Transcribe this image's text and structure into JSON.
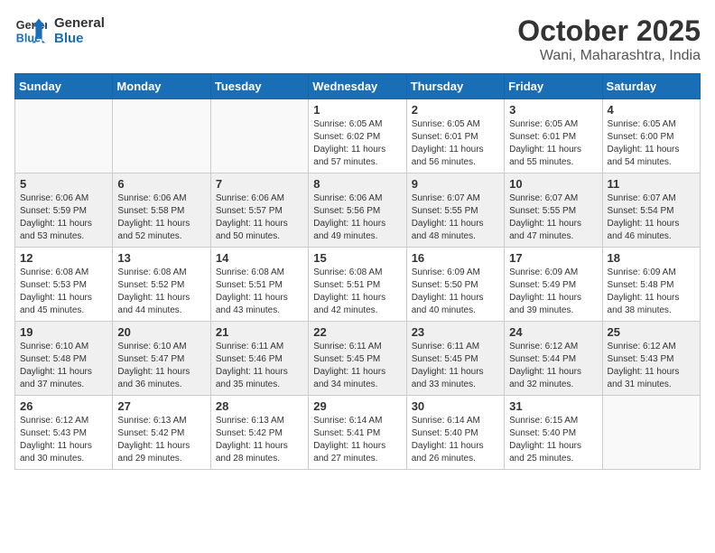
{
  "header": {
    "logo_line1": "General",
    "logo_line2": "Blue",
    "month": "October 2025",
    "location": "Wani, Maharashtra, India"
  },
  "weekdays": [
    "Sunday",
    "Monday",
    "Tuesday",
    "Wednesday",
    "Thursday",
    "Friday",
    "Saturday"
  ],
  "weeks": [
    [
      {
        "day": "",
        "info": ""
      },
      {
        "day": "",
        "info": ""
      },
      {
        "day": "",
        "info": ""
      },
      {
        "day": "1",
        "info": "Sunrise: 6:05 AM\nSunset: 6:02 PM\nDaylight: 11 hours\nand 57 minutes."
      },
      {
        "day": "2",
        "info": "Sunrise: 6:05 AM\nSunset: 6:01 PM\nDaylight: 11 hours\nand 56 minutes."
      },
      {
        "day": "3",
        "info": "Sunrise: 6:05 AM\nSunset: 6:01 PM\nDaylight: 11 hours\nand 55 minutes."
      },
      {
        "day": "4",
        "info": "Sunrise: 6:05 AM\nSunset: 6:00 PM\nDaylight: 11 hours\nand 54 minutes."
      }
    ],
    [
      {
        "day": "5",
        "info": "Sunrise: 6:06 AM\nSunset: 5:59 PM\nDaylight: 11 hours\nand 53 minutes."
      },
      {
        "day": "6",
        "info": "Sunrise: 6:06 AM\nSunset: 5:58 PM\nDaylight: 11 hours\nand 52 minutes."
      },
      {
        "day": "7",
        "info": "Sunrise: 6:06 AM\nSunset: 5:57 PM\nDaylight: 11 hours\nand 50 minutes."
      },
      {
        "day": "8",
        "info": "Sunrise: 6:06 AM\nSunset: 5:56 PM\nDaylight: 11 hours\nand 49 minutes."
      },
      {
        "day": "9",
        "info": "Sunrise: 6:07 AM\nSunset: 5:55 PM\nDaylight: 11 hours\nand 48 minutes."
      },
      {
        "day": "10",
        "info": "Sunrise: 6:07 AM\nSunset: 5:55 PM\nDaylight: 11 hours\nand 47 minutes."
      },
      {
        "day": "11",
        "info": "Sunrise: 6:07 AM\nSunset: 5:54 PM\nDaylight: 11 hours\nand 46 minutes."
      }
    ],
    [
      {
        "day": "12",
        "info": "Sunrise: 6:08 AM\nSunset: 5:53 PM\nDaylight: 11 hours\nand 45 minutes."
      },
      {
        "day": "13",
        "info": "Sunrise: 6:08 AM\nSunset: 5:52 PM\nDaylight: 11 hours\nand 44 minutes."
      },
      {
        "day": "14",
        "info": "Sunrise: 6:08 AM\nSunset: 5:51 PM\nDaylight: 11 hours\nand 43 minutes."
      },
      {
        "day": "15",
        "info": "Sunrise: 6:08 AM\nSunset: 5:51 PM\nDaylight: 11 hours\nand 42 minutes."
      },
      {
        "day": "16",
        "info": "Sunrise: 6:09 AM\nSunset: 5:50 PM\nDaylight: 11 hours\nand 40 minutes."
      },
      {
        "day": "17",
        "info": "Sunrise: 6:09 AM\nSunset: 5:49 PM\nDaylight: 11 hours\nand 39 minutes."
      },
      {
        "day": "18",
        "info": "Sunrise: 6:09 AM\nSunset: 5:48 PM\nDaylight: 11 hours\nand 38 minutes."
      }
    ],
    [
      {
        "day": "19",
        "info": "Sunrise: 6:10 AM\nSunset: 5:48 PM\nDaylight: 11 hours\nand 37 minutes."
      },
      {
        "day": "20",
        "info": "Sunrise: 6:10 AM\nSunset: 5:47 PM\nDaylight: 11 hours\nand 36 minutes."
      },
      {
        "day": "21",
        "info": "Sunrise: 6:11 AM\nSunset: 5:46 PM\nDaylight: 11 hours\nand 35 minutes."
      },
      {
        "day": "22",
        "info": "Sunrise: 6:11 AM\nSunset: 5:45 PM\nDaylight: 11 hours\nand 34 minutes."
      },
      {
        "day": "23",
        "info": "Sunrise: 6:11 AM\nSunset: 5:45 PM\nDaylight: 11 hours\nand 33 minutes."
      },
      {
        "day": "24",
        "info": "Sunrise: 6:12 AM\nSunset: 5:44 PM\nDaylight: 11 hours\nand 32 minutes."
      },
      {
        "day": "25",
        "info": "Sunrise: 6:12 AM\nSunset: 5:43 PM\nDaylight: 11 hours\nand 31 minutes."
      }
    ],
    [
      {
        "day": "26",
        "info": "Sunrise: 6:12 AM\nSunset: 5:43 PM\nDaylight: 11 hours\nand 30 minutes."
      },
      {
        "day": "27",
        "info": "Sunrise: 6:13 AM\nSunset: 5:42 PM\nDaylight: 11 hours\nand 29 minutes."
      },
      {
        "day": "28",
        "info": "Sunrise: 6:13 AM\nSunset: 5:42 PM\nDaylight: 11 hours\nand 28 minutes."
      },
      {
        "day": "29",
        "info": "Sunrise: 6:14 AM\nSunset: 5:41 PM\nDaylight: 11 hours\nand 27 minutes."
      },
      {
        "day": "30",
        "info": "Sunrise: 6:14 AM\nSunset: 5:40 PM\nDaylight: 11 hours\nand 26 minutes."
      },
      {
        "day": "31",
        "info": "Sunrise: 6:15 AM\nSunset: 5:40 PM\nDaylight: 11 hours\nand 25 minutes."
      },
      {
        "day": "",
        "info": ""
      }
    ]
  ]
}
